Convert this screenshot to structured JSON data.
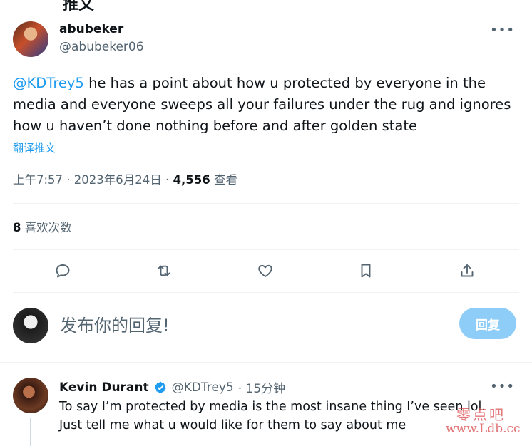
{
  "header": {
    "title_fragment": "推文"
  },
  "tweet": {
    "author_name": "abubeker",
    "author_handle": "@abubeker06",
    "more_label": "•••",
    "mention": "@KDTrey5",
    "body": " he has a point about how u protected by everyone in the media and everyone sweeps all your failures under the rug and ignores how u haven’t done nothing before and after golden state",
    "translate_label": "翻译推文",
    "timestamp": "上午7:57 · 2023年6月24日 · ",
    "views_count": "4,556",
    "views_label": " 查看",
    "likes_count": "8",
    "likes_label": " 喜欢次数"
  },
  "actions": {
    "reply": "reply-icon",
    "retweet": "retweet-icon",
    "like": "heart-icon",
    "bookmark": "bookmark-icon",
    "share": "share-icon"
  },
  "composer": {
    "placeholder": "发布你的回复!",
    "button_label": "回复"
  },
  "reply": {
    "author_name": "Kevin Durant",
    "author_handle": "@KDTrey5",
    "time": "· 15分钟",
    "more_label": "•••",
    "body": "To say I’m protected by media is the most insane thing I’ve seen lol. Just tell me what u would like for them to say about me"
  },
  "watermark": {
    "line1": "零点吧",
    "line2": "www.Ldb.cc"
  },
  "colors": {
    "accent": "#1d9bf0",
    "muted": "#536471",
    "button_disabled": "#8ecdf8",
    "watermark": "#d7474a"
  }
}
